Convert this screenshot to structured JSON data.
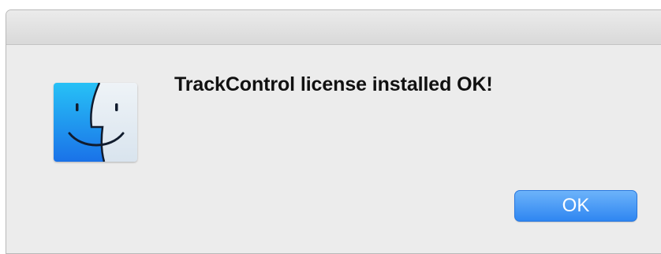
{
  "dialog": {
    "message": "TrackControl license installed OK!",
    "icon": "finder-icon",
    "ok_label": "OK"
  },
  "colors": {
    "accent": "#2f86f1",
    "background": "#ececec"
  }
}
